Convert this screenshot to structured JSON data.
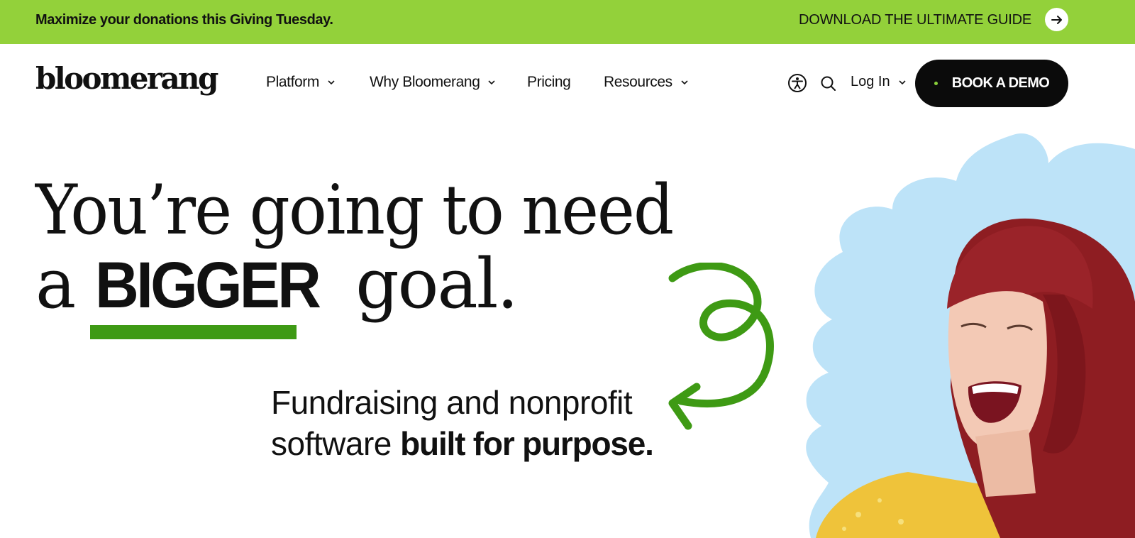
{
  "promo": {
    "text": "Maximize your donations this Giving Tuesday.",
    "link": "DOWNLOAD THE ULTIMATE GUIDE",
    "arrow_icon": "arrow-right-icon"
  },
  "header": {
    "logo": "bloomerang",
    "nav": [
      {
        "label": "Platform",
        "has_dropdown": true
      },
      {
        "label": "Why Bloomerang",
        "has_dropdown": true
      },
      {
        "label": "Pricing",
        "has_dropdown": false
      },
      {
        "label": "Resources",
        "has_dropdown": true
      }
    ],
    "accessibility_icon": "accessibility-icon",
    "search_icon": "search-icon",
    "login_label": "Log In",
    "demo_label": "BOOK A DEMO"
  },
  "hero": {
    "line1": "You’re going to need",
    "line2_a": "a",
    "line2_big": "BIGGER",
    "line2_b": "goal.",
    "sub_line1": "Fundraising and nonprofit",
    "sub_line2_regular": "software",
    "sub_line2_bold": "built for purpose."
  },
  "colors": {
    "promo_bg": "#93d13a",
    "accent_green": "#3e9a14",
    "button_bg": "#0b0b0b",
    "blob_blue": "#bde3f8"
  }
}
